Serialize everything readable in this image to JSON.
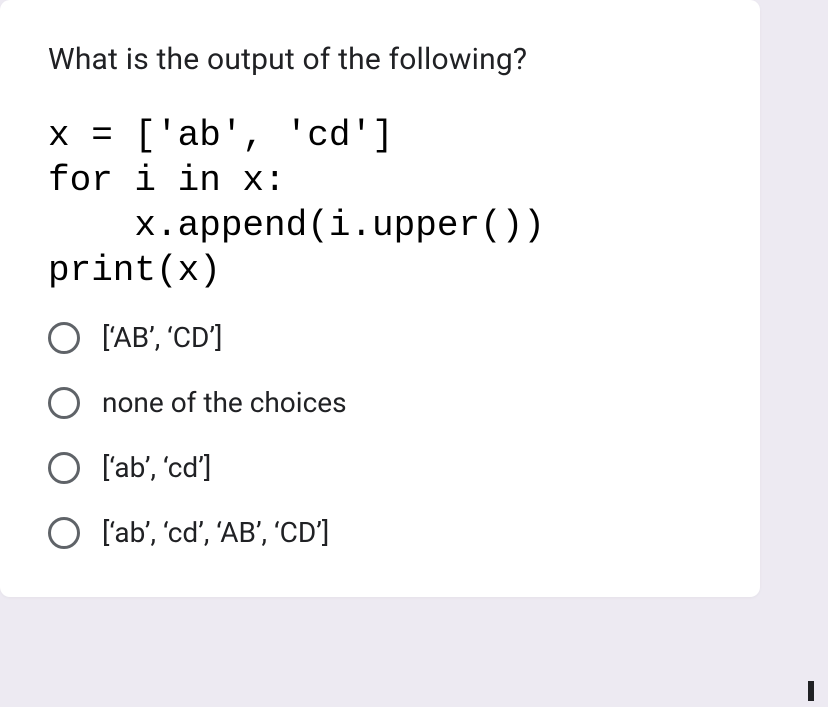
{
  "question": {
    "title": "What is the output of the following?",
    "code_lines": [
      "x = ['ab', 'cd']",
      "for i in x:",
      "    x.append(i.upper())",
      "print(x)"
    ]
  },
  "options": [
    {
      "label": "[‘AB’, ‘CD’]"
    },
    {
      "label": "none of the choices"
    },
    {
      "label": "[‘ab’, ‘cd’]"
    },
    {
      "label": "[‘ab’, ‘cd’, ‘AB’, ‘CD’]"
    }
  ]
}
